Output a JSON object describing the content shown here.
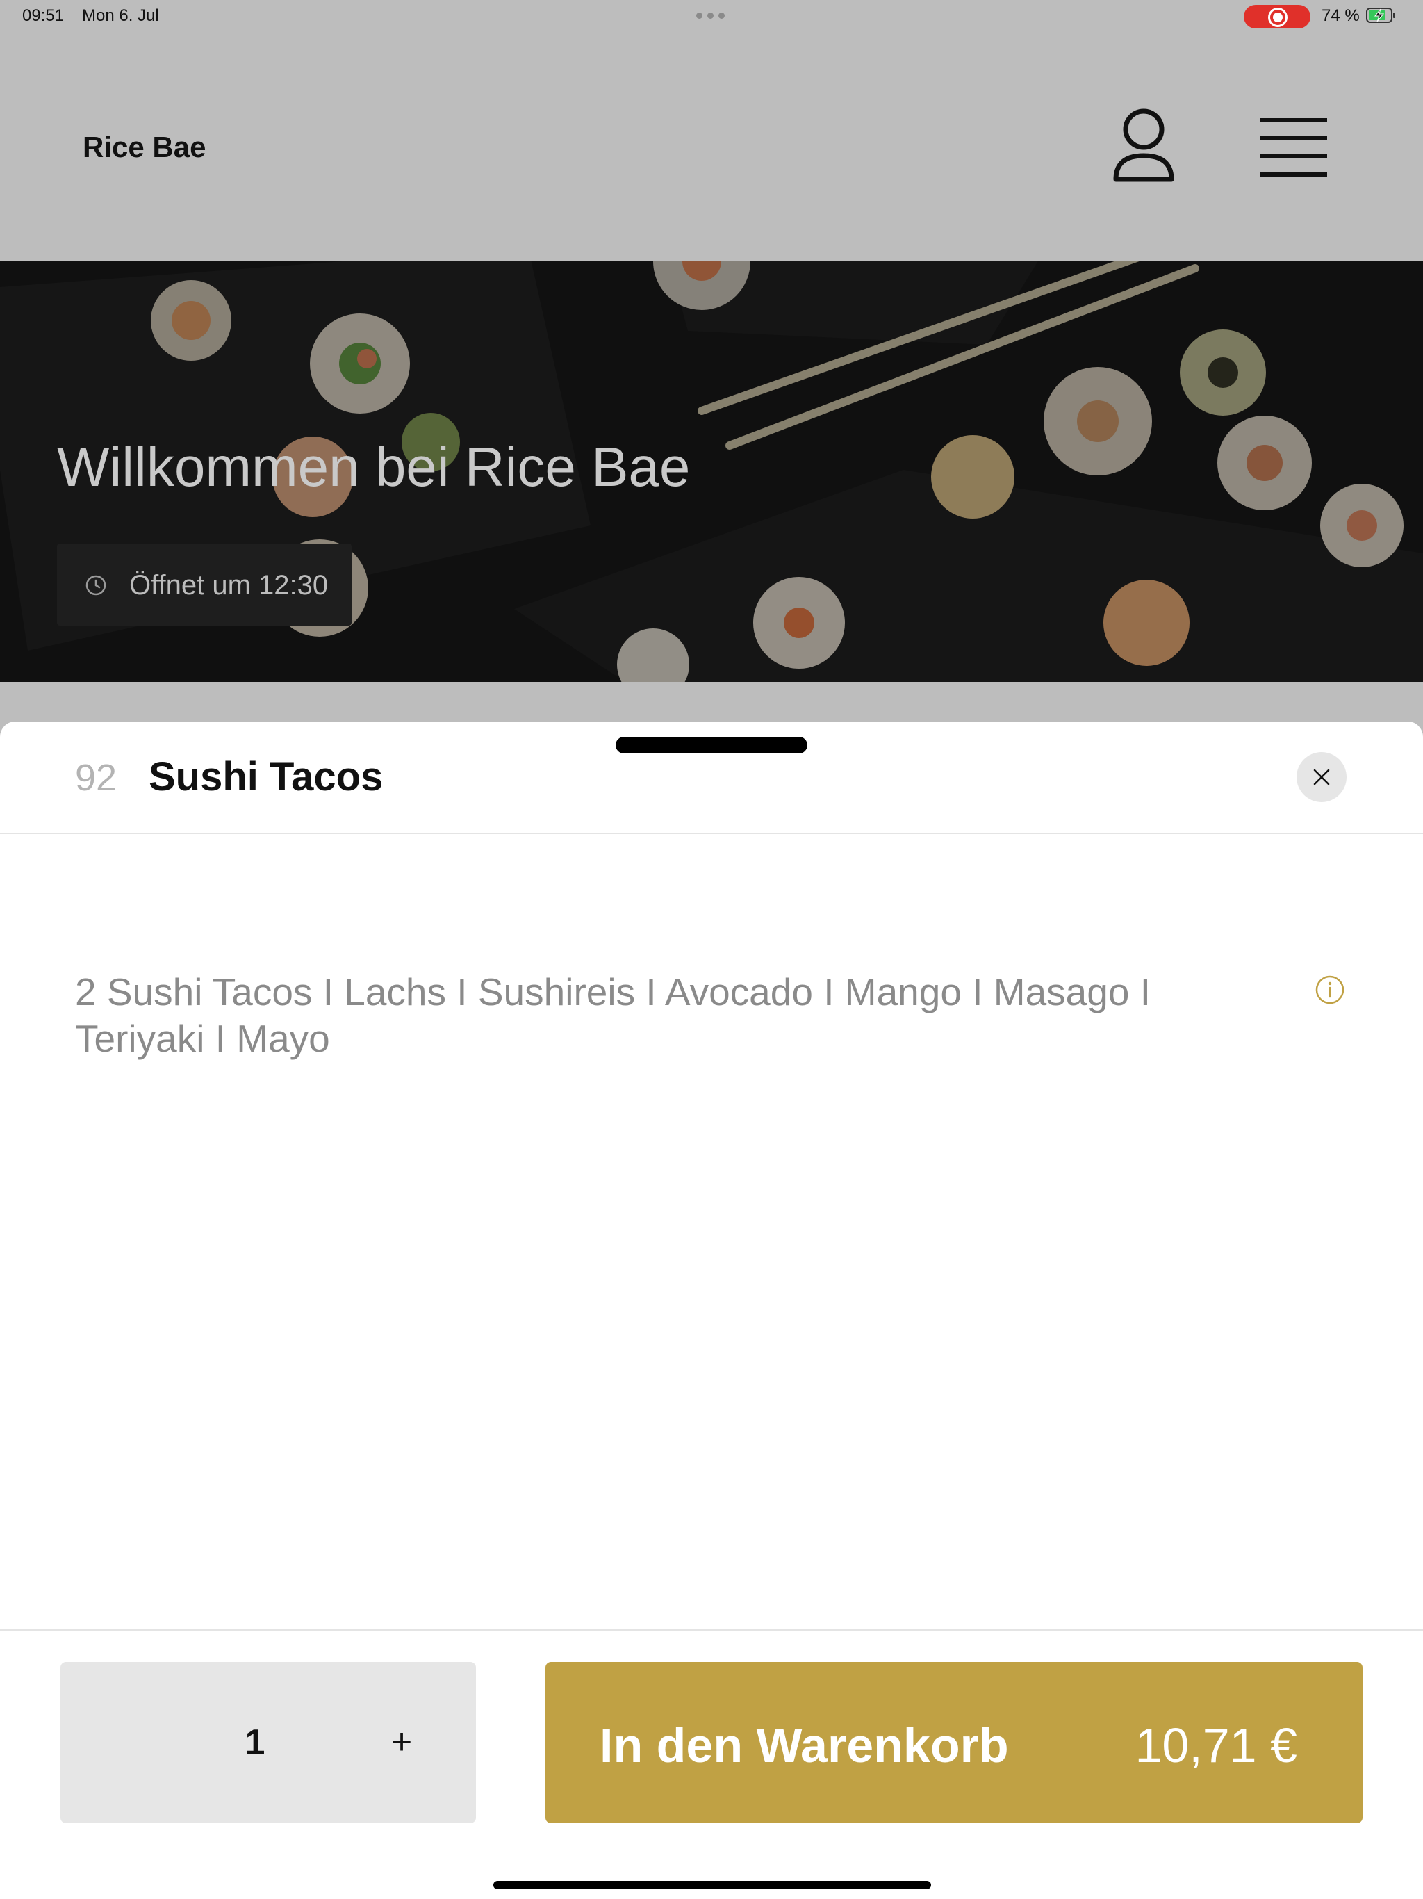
{
  "status_bar": {
    "time": "09:51",
    "date": "Mon 6. Jul",
    "battery_percent": "74 %",
    "recording_color": "#e0302a"
  },
  "header": {
    "brand": "Rice Bae",
    "account_icon": "person-icon",
    "menu_icon": "hamburger-menu-icon"
  },
  "hero": {
    "title": "Willkommen bei Rice Bae",
    "hours_text": "Öffnet um 12:30",
    "hours_icon": "clock-icon"
  },
  "item_sheet": {
    "number": "92",
    "title": "Sushi Tacos",
    "description": "2 Sushi Tacos I Lachs I Sushireis I Avocado I Mango I Masago I Teriyaki I Mayo",
    "close_icon": "close-icon",
    "info_icon": "info-icon"
  },
  "footer": {
    "quantity": "1",
    "plus_label": "+",
    "add_to_cart_label": "In den Warenkorb",
    "price": "10,71 €",
    "accent_color": "#c0a144"
  }
}
